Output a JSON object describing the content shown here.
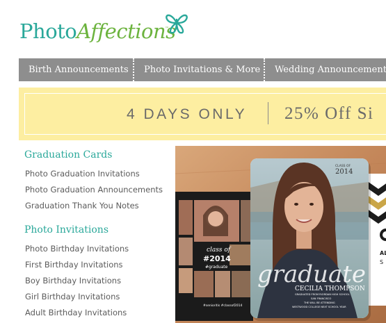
{
  "logo": {
    "part1": "Photo",
    "part2": "Affections",
    "tm": "™"
  },
  "nav": {
    "items": [
      {
        "label": "Birth Announcements"
      },
      {
        "label": "Photo Invitations & More"
      },
      {
        "label": "Wedding Announcements"
      }
    ]
  },
  "promo": {
    "left": "4 DAYS ONLY",
    "right": "25% Off Si"
  },
  "sidebar": {
    "sections": [
      {
        "title": "Graduation Cards",
        "links": [
          "Photo Graduation Invitations",
          "Photo Graduation Announcements",
          "Graduation Thank You Notes"
        ]
      },
      {
        "title": "Photo Invitations",
        "links": [
          "Photo Birthday Invitations",
          "First Birthday Invitations",
          "Boy Birthday Invitations",
          "Girl Birthday Invitations",
          "Adult Birthday Invitations"
        ]
      }
    ]
  },
  "hero": {
    "card_main": {
      "class_label": "CLASS OF",
      "year": "2014",
      "script": "graduate",
      "name": "CECILIA THOMPSON",
      "line1": "GRADUATED FROM RIORDAN HIGH SCHOOL",
      "line2": "SAN FRANCISCO",
      "line3": "THE WILL BE ATTENDING",
      "line4": "WESTWOOD COLLEGE NEXT SCHOOL YEAR"
    },
    "card_left": {
      "script": "class of",
      "year": "#2014",
      "tag": "#graduate",
      "footer": "#senioritis #classof2014"
    },
    "card_right": {
      "text1": "ALE",
      "text2": "S"
    }
  },
  "colors": {
    "teal": "#2aa89a",
    "green": "#6cb33e",
    "nav_bg": "#8e8e8e",
    "promo_bg": "#fdeea1"
  }
}
